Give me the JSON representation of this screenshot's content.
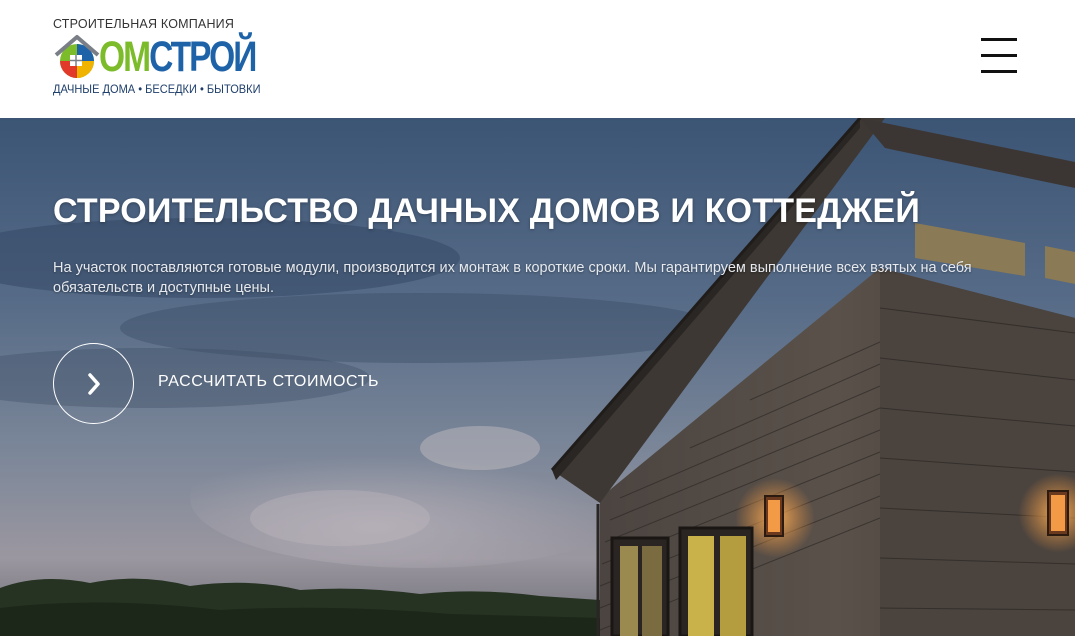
{
  "header": {
    "logo": {
      "top_text": "СТРОИТЕЛЬНАЯ КОМПАНИЯ",
      "word_part1": "ОМ",
      "word_part2": "СТРОЙ",
      "bottom_text": "ДАЧНЫЕ ДОМА • БЕСЕДКИ • БЫТОВКИ",
      "icon": "house-logo-icon"
    },
    "menu_icon": "hamburger-menu-icon"
  },
  "hero": {
    "title": "СТРОИТЕЛЬСТВО ДАЧНЫХ ДОМОВ И КОТТЕДЖЕЙ",
    "description": "На участок поставляются готовые модули, производится их монтаж в короткие сроки. Мы гарантируем выполнение всех взятых на себя обязательств и доступные цены.",
    "cta_label": "РАССЧИТАТЬ СТОИМОСТЬ",
    "cta_icon": "chevron-right-icon"
  },
  "colors": {
    "logo_green": "#7cbb2a",
    "logo_blue": "#1e63a8",
    "text_white": "#ffffff"
  }
}
